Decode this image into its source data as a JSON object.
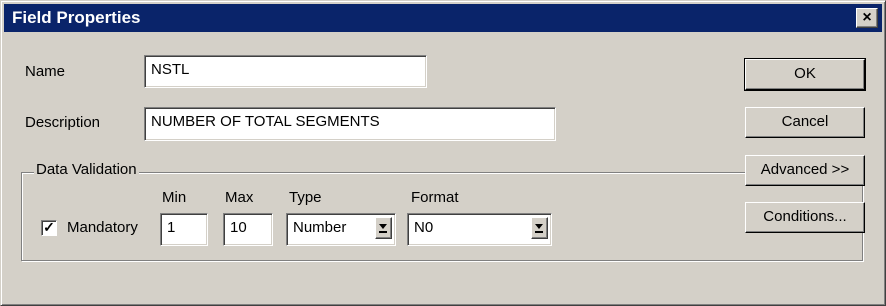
{
  "dialog": {
    "title": "Field Properties",
    "close_glyph": "×"
  },
  "fields": {
    "name_label": "Name",
    "name_value": "NSTL",
    "description_label": "Description",
    "description_value": "NUMBER OF TOTAL SEGMENTS"
  },
  "validation": {
    "group_label": "Data Validation",
    "mandatory_label": "Mandatory",
    "mandatory_checked": true,
    "check_glyph": "✓",
    "min_label": "Min",
    "min_value": "1",
    "max_label": "Max",
    "max_value": "10",
    "type_label": "Type",
    "type_value": "Number",
    "format_label": "Format",
    "format_value": "N0"
  },
  "buttons": {
    "ok": "OK",
    "cancel": "Cancel",
    "advanced": "Advanced >>",
    "conditions": "Conditions..."
  }
}
